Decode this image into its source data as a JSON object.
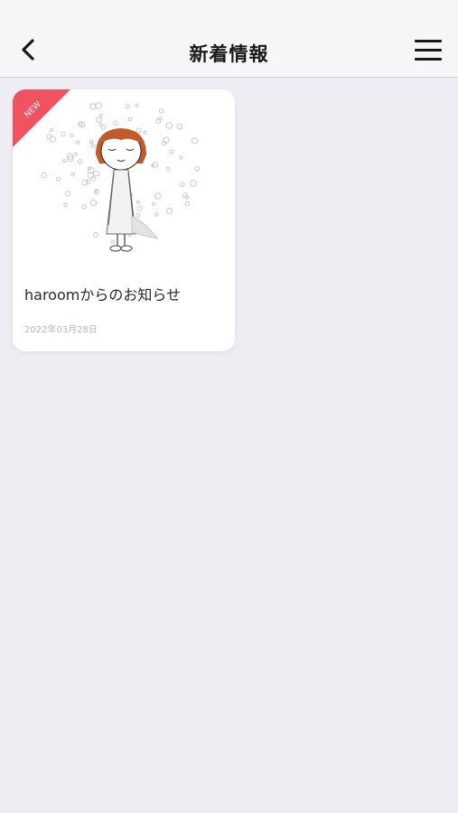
{
  "header": {
    "title": "新着情報",
    "back_icon": "chevron-left-icon",
    "menu_icon": "hamburger-menu-icon"
  },
  "news_items": [
    {
      "badge": "NEW",
      "title": "haroomからのお知らせ",
      "date": "2022年03月28日"
    }
  ],
  "colors": {
    "background": "#eeedf3",
    "header_bg": "#f6f6f9",
    "badge": "#f0525f",
    "card_bg": "#ffffff",
    "hair": "#c25a2c"
  }
}
